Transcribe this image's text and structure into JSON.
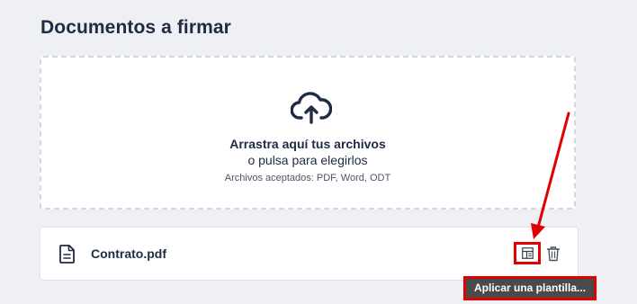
{
  "section": {
    "title": "Documentos a firmar"
  },
  "dropzone": {
    "primary": "Arrastra aquí tus archivos",
    "secondary": "o pulsa para elegirlos",
    "hint": "Archivos aceptados: PDF, Word, ODT",
    "icon": "cloud-upload-icon"
  },
  "file": {
    "name": "Contrato.pdf",
    "icon": "document-icon",
    "actions": [
      {
        "icon": "template-icon",
        "highlighted": true
      },
      {
        "icon": "trash-icon"
      }
    ]
  },
  "tooltip": {
    "text": "Aplicar una plantilla..."
  },
  "annotation": {
    "highlight_color": "#e00000"
  }
}
